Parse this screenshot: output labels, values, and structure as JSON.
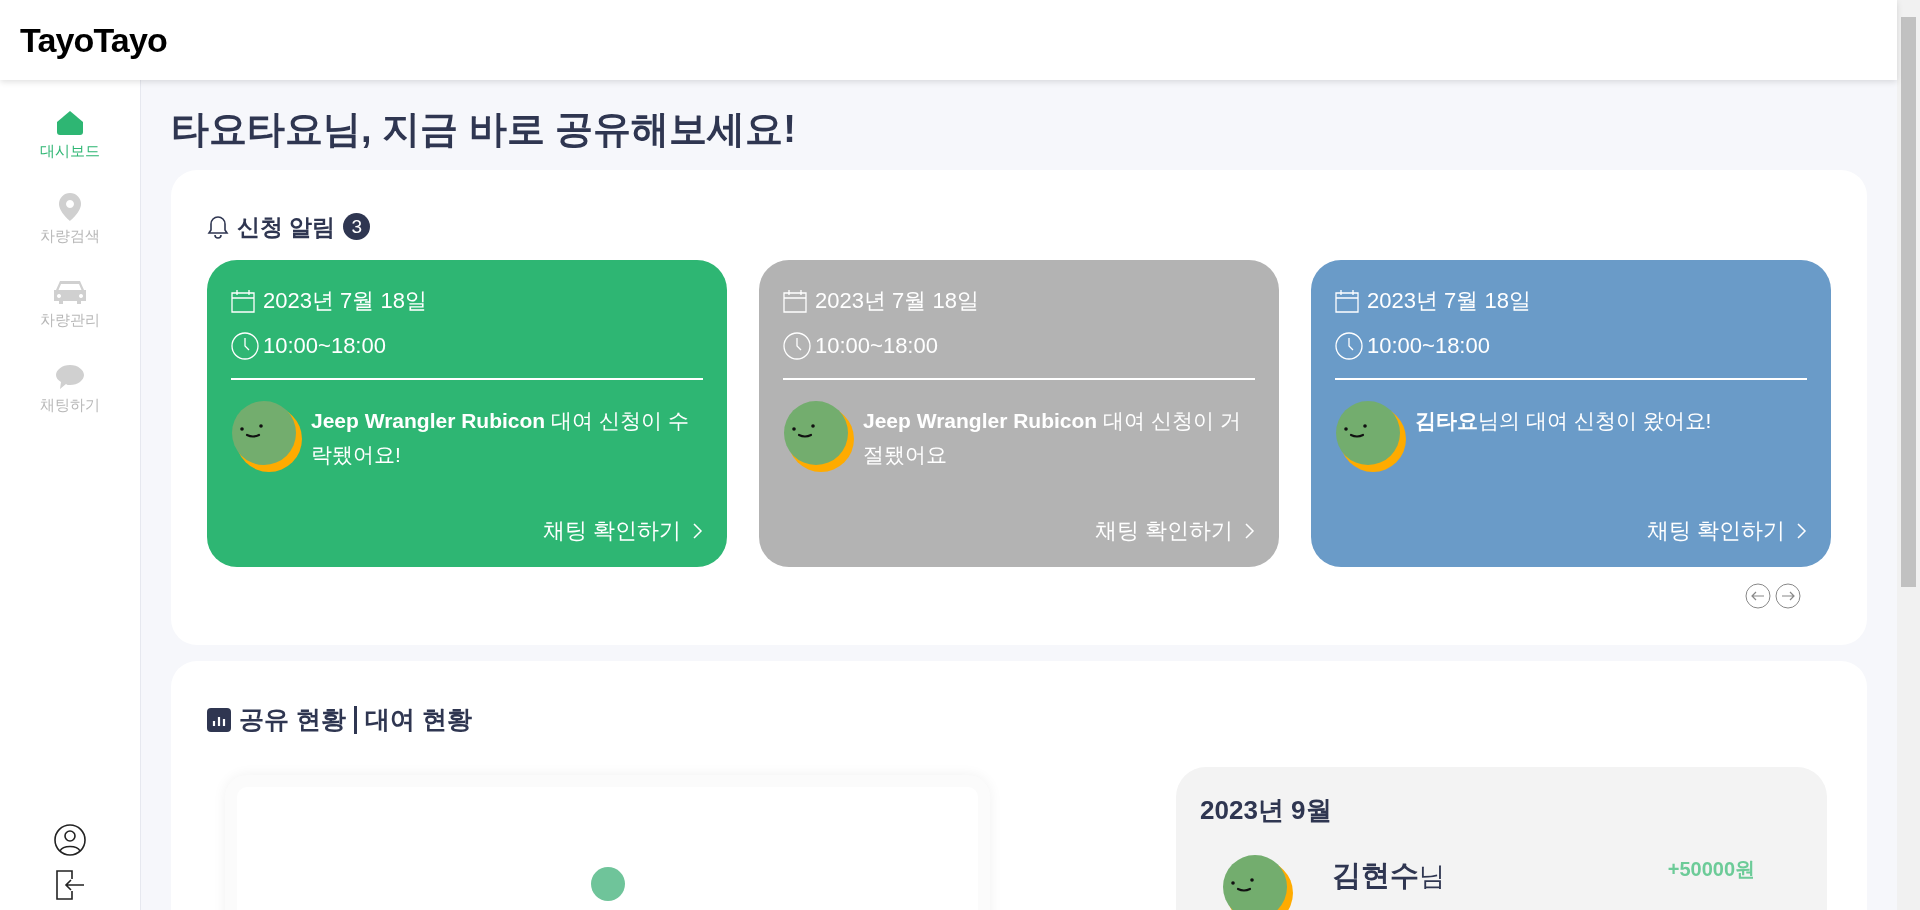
{
  "header": {
    "logo": "TayoTayo"
  },
  "sidebar": {
    "items": [
      {
        "kind": "home",
        "label": "대시보드",
        "selected": true
      },
      {
        "kind": "pin",
        "label": "차량검색",
        "selected": false
      },
      {
        "kind": "car",
        "label": "차량관리",
        "selected": false
      },
      {
        "kind": "chat",
        "label": "채팅하기",
        "selected": false
      }
    ]
  },
  "page_title": "타요타요님, 지금 바로 공유해보세요!",
  "notifications": {
    "title": "신청 알림",
    "count": "3",
    "cards": [
      {
        "color": "#2eb673",
        "date": "2023년 7월 18일",
        "time": "10:00~18:00",
        "message": "**Jeep Wrangler Rubicon** 대여 신청이 수락됐어요!",
        "link": "채팅 확인하기"
      },
      {
        "color": "#b3b3b3",
        "date": "2023년 7월 18일",
        "time": "10:00~18:00",
        "message": "**Jeep Wrangler Rubicon** 대여 신청이 거절됐어요",
        "link": "채팅 확인하기"
      },
      {
        "color": "#6a9bc8",
        "date": "2023년 7월 18일",
        "time": "10:00~18:00",
        "message": "**김타요**님의 대여 신청이 왔어요!",
        "link": "채팅 확인하기"
      }
    ]
  },
  "status": {
    "title_left": "공유 현황",
    "title_right": "대여 현황",
    "month": "2023년 9월",
    "entries": [
      {
        "name": "김현수",
        "suffix": "님",
        "amount": "+50000원"
      }
    ]
  }
}
